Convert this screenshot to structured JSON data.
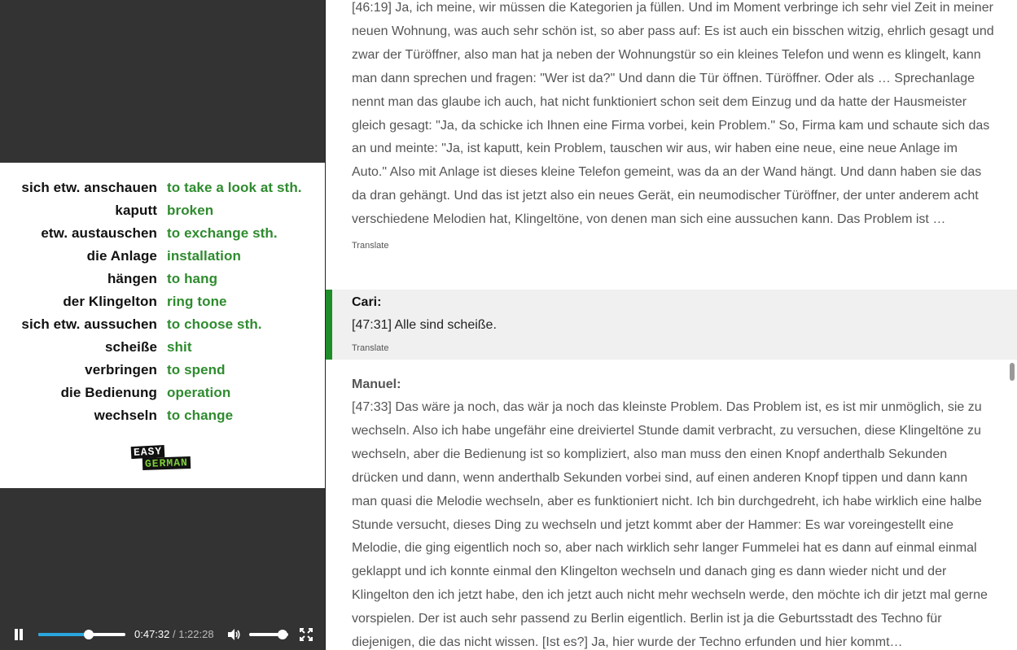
{
  "vocabulary": [
    {
      "de": "sich etw. anschauen",
      "en": "to take a look at sth."
    },
    {
      "de": "kaputt",
      "en": "broken"
    },
    {
      "de": "etw. austauschen",
      "en": "to exchange sth."
    },
    {
      "de": "die Anlage",
      "en": "installation"
    },
    {
      "de": "hängen",
      "en": "to hang"
    },
    {
      "de": "der Klingelton",
      "en": "ring tone"
    },
    {
      "de": "sich etw. aussuchen",
      "en": "to choose sth."
    },
    {
      "de": "scheiße",
      "en": "shit"
    },
    {
      "de": "verbringen",
      "en": "to spend"
    },
    {
      "de": "die Bedienung",
      "en": "operation"
    },
    {
      "de": "wechseln",
      "en": "to change"
    }
  ],
  "logo": {
    "line1": "EASY",
    "line2": "GERMAN"
  },
  "player": {
    "current_time": "0:47:32",
    "separator": " / ",
    "total_time": "1:22:28",
    "progress": 0.576,
    "volume": 0.85,
    "icons": {
      "play": "pause-icon",
      "volume": "volume-icon",
      "fullscreen": "fullscreen-icon"
    }
  },
  "transcript": [
    {
      "speaker": "",
      "text": "[46:19] Ja, ich meine, wir müssen die Kategorien ja füllen. Und im Moment verbringe ich sehr viel Zeit in meiner neuen Wohnung, was auch sehr schön ist, so aber pass auf: Es ist auch ein bisschen witzig, ehrlich gesagt und zwar der Türöffner, also man hat ja neben der Wohnungstür so ein kleines Telefon und wenn es klingelt, kann man dann sprechen und fragen: \"Wer ist da?\" Und dann die Tür öffnen. Türöffner. Oder als … Sprechanlage nennt man das glaube ich auch, hat nicht funktioniert schon seit dem Einzug und da hatte der Hausmeister gleich gesagt: \"Ja, da schicke ich Ihnen eine Firma vorbei, kein Problem.\" So, Firma kam und schaute sich das an und meinte: \"Ja, ist kaputt, kein Problem, tauschen wir aus, wir haben eine neue, eine neue Anlage im Auto.\" Also mit Anlage ist dieses kleine Telefon gemeint, was da an der Wand hängt. Und dann haben sie das da dran gehängt. Und das ist jetzt also ein neues Gerät, ein neumodischer Türöffner, der unter anderem acht verschiedene Melodien hat, Klingeltöne, von denen man sich eine aussuchen kann. Das Problem ist …",
      "translate_label": "Translate",
      "active": false
    },
    {
      "speaker": "Cari:",
      "text": "[47:31] Alle sind scheiße.",
      "translate_label": "Translate",
      "active": true
    },
    {
      "speaker": "Manuel:",
      "text": "[47:33] Das wäre ja noch, das wär ja noch das kleinste Problem. Das Problem ist, es ist mir unmöglich, sie zu wechseln. Also ich habe ungefähr eine dreiviertel Stunde damit verbracht, zu versuchen, diese Klingeltöne zu wechseln, aber die Bedienung ist so kompliziert, also man muss den einen Knopf anderthalb Sekunden drücken und dann, wenn anderthalb Sekunden vorbei sind, auf einen anderen Knopf tippen und dann kann man quasi die Melodie wechseln, aber es funktioniert nicht. Ich bin durchgedreht, ich habe wirklich eine halbe Stunde versucht, dieses Ding zu wechseln und jetzt kommt aber der Hammer: Es war voreingestellt eine Melodie, die ging eigentlich noch so, aber nach wirklich sehr langer Fummelei hat es dann auf einmal einmal geklappt und ich konnte einmal den Klingelton wechseln und danach ging es dann wieder nicht und der Klingelton den ich jetzt habe, den ich jetzt auch nicht mehr wechseln werde, den möchte ich dir jetzt mal gerne vorspielen. Der ist auch sehr passend zu Berlin eigentlich. Berlin ist ja die Geburtsstadt des Techno für diejenigen, die das nicht wissen. [Ist es?] Ja, hier wurde der Techno erfunden und hier kommt…",
      "translate_label": "",
      "active": false
    }
  ],
  "colors": {
    "accent_green": "#1f8c2a",
    "vocab_green": "#2e8b2e",
    "progress_blue": "#2aa6de"
  }
}
